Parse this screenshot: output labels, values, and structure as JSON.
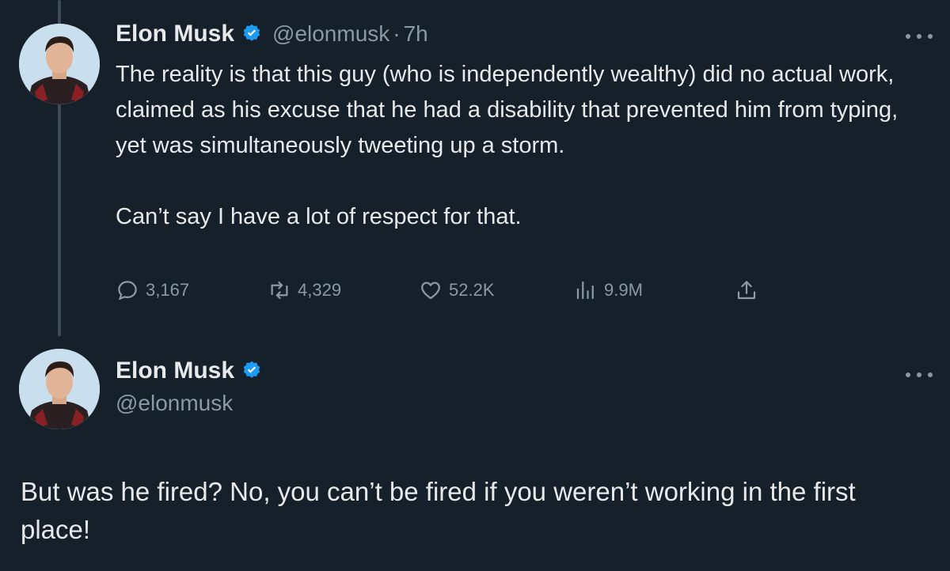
{
  "tweet1": {
    "author_name": "Elon Musk",
    "handle": "@elonmusk",
    "separator": "·",
    "time": "7h",
    "text_paragraph_1": "The reality is that this guy (who is independently wealthy) did no actual work, claimed as his excuse that he had a disability that prevented him from typing, yet was simultaneously tweeting up a storm.",
    "text_paragraph_2": "Can’t say I have a lot of respect for that.",
    "replies": "3,167",
    "retweets": "4,329",
    "likes": "52.2K",
    "views": "9.9M"
  },
  "tweet2": {
    "author_name": "Elon Musk",
    "handle": "@elonmusk",
    "text": "But was he fired? No, you can’t be fired if you weren’t working in the first place!"
  },
  "colors": {
    "background": "#15202b",
    "text": "#e7e9ea",
    "secondary": "#8b98a5",
    "verified": "#1d9bf0",
    "thread_line": "#3d4a57"
  }
}
